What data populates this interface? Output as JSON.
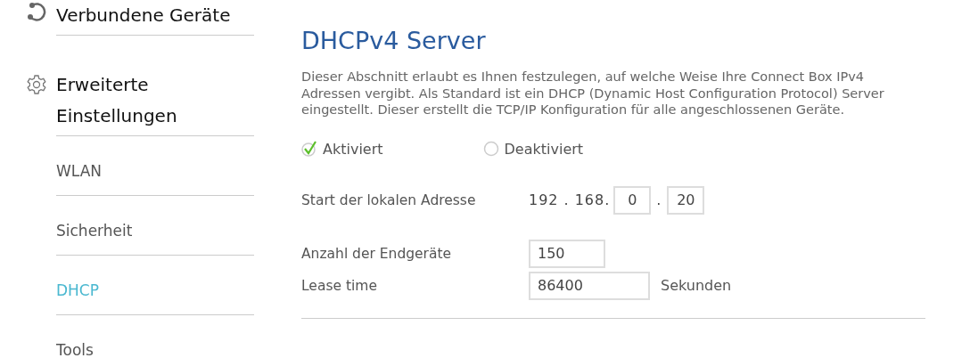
{
  "sidebar": {
    "sections": [
      {
        "kind": "devices",
        "label": "Verbundene Geräte"
      },
      {
        "kind": "settings",
        "label": "Erweiterte Einstellungen",
        "items": [
          {
            "label": "WLAN",
            "selected": false
          },
          {
            "label": "Sicherheit",
            "selected": false
          },
          {
            "label": "DHCP",
            "selected": true
          },
          {
            "label": "Tools",
            "selected": false
          }
        ]
      }
    ]
  },
  "content": {
    "title": "DHCPv4 Server",
    "description": "Dieser Abschnitt erlaubt es Ihnen festzulegen, auf welche Weise Ihre Connect Box IPv4 Adressen vergibt. Als Standard ist ein DHCP (Dynamic Host Configuration Protocol) Server eingestellt. Dieser erstellt die TCP/IP Konfiguration für alle angeschlossenen Geräte.",
    "mode_options": [
      {
        "label": "Aktiviert",
        "selected": true
      },
      {
        "label": "Deaktiviert",
        "selected": false
      }
    ],
    "start_address": {
      "label": "Start der lokalen Adresse",
      "prefix_1": "192",
      "dot_1": ".",
      "prefix_2": "168",
      "dot_2": ".",
      "octet_3": "0",
      "dot_3": ".",
      "octet_4": "20"
    },
    "device_count": {
      "label": "Anzahl der Endgeräte",
      "value": "150"
    },
    "lease_time": {
      "label": "Lease time",
      "value": "86400",
      "unit": "Sekunden"
    }
  }
}
